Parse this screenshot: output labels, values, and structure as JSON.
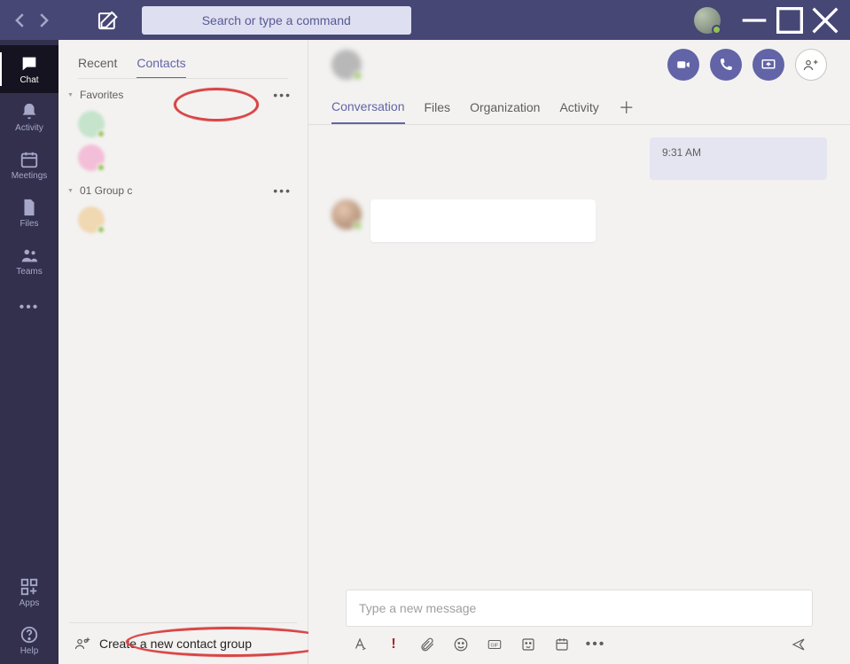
{
  "title_bar": {
    "search_placeholder": "Search or type a command"
  },
  "rail": {
    "chat": "Chat",
    "activity": "Activity",
    "meetings": "Meetings",
    "files": "Files",
    "teams": "Teams",
    "apps": "Apps",
    "help": "Help"
  },
  "chat_panel": {
    "tabs": {
      "recent": "Recent",
      "contacts": "Contacts"
    },
    "groups": {
      "favorites_label": "Favorites",
      "group1_label": "01 Group c"
    },
    "create_group_label": "Create a new contact group"
  },
  "content": {
    "tabs": {
      "conversation": "Conversation",
      "files": "Files",
      "organization": "Organization",
      "activity": "Activity"
    },
    "messages": {
      "time_1": "9:31 AM"
    },
    "compose_placeholder": "Type a new message"
  }
}
